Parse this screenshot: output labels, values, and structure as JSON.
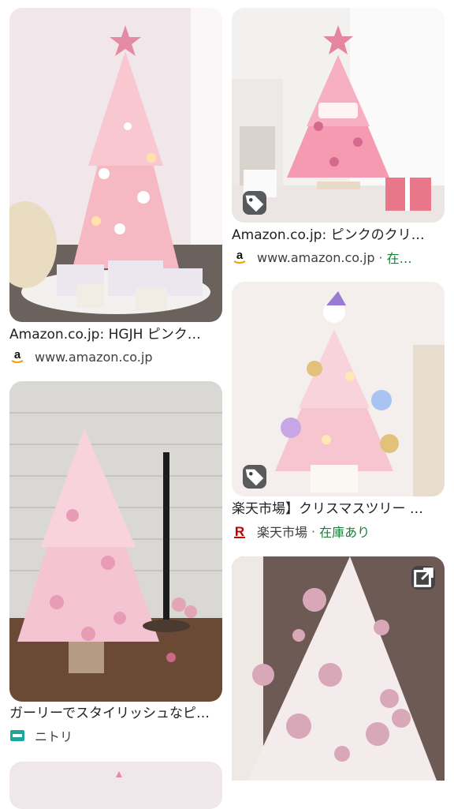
{
  "results": {
    "left": [
      {
        "title": "Amazon.co.jp: HGJH ピンク…",
        "source": "www.amazon.co.jp",
        "favicon": "amazon-icon"
      },
      {
        "title": "ガーリーでスタイリッシュなピ…",
        "source": "ニトリ",
        "favicon": "nitori-icon"
      }
    ],
    "right": [
      {
        "title": "Amazon.co.jp: ピンクのクリ…",
        "source": "www.amazon.co.jp",
        "stock": "在…",
        "favicon": "amazon-icon",
        "badge": "tag-icon"
      },
      {
        "title": "楽天市場】クリスマスツリー …",
        "source": "楽天市場",
        "stock": "在庫あり",
        "favicon": "rakuten-icon",
        "badge": "tag-icon"
      },
      {
        "badge": "open-in-new-icon"
      }
    ]
  },
  "colors": {
    "stock_green": "#188038",
    "tree_pink": "#f4b6c6"
  }
}
